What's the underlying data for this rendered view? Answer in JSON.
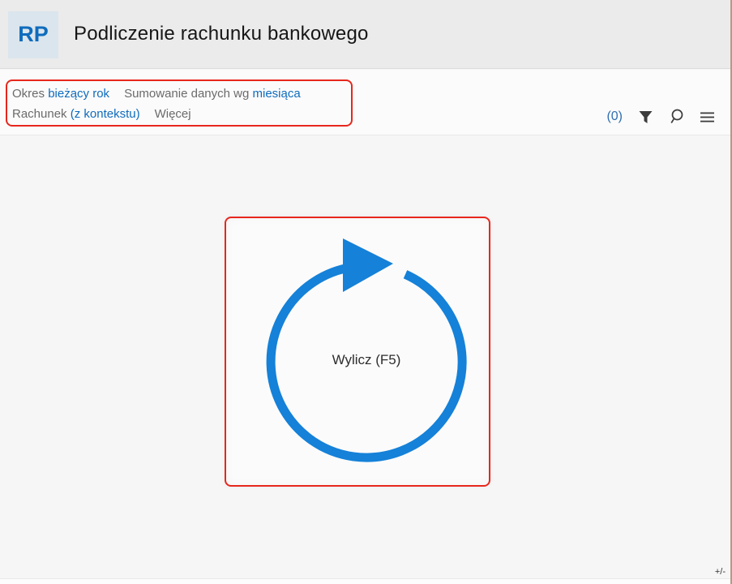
{
  "header": {
    "badge": "RP",
    "title": "Podliczenie rachunku bankowego"
  },
  "toolbar": {
    "menu": {
      "okres_label": "Okres",
      "okres_value": "bieżący rok",
      "sumowanie_label": "Sumowanie danych wg",
      "sumowanie_value": "miesiąca",
      "rachunek_label": "Rachunek",
      "rachunek_value": "(z kontekstu)",
      "wiecej_label": "Więcej"
    },
    "filter_count": "(0)",
    "icons": {
      "filter": "funnel-icon",
      "search": "magnifier-icon",
      "menu": "hamburger-menu-icon"
    }
  },
  "main": {
    "run_button": {
      "label": "Wylicz (F5)",
      "icon": "circular-arrow-refresh-icon"
    }
  },
  "footer": {
    "zoom_hint": "+/-"
  },
  "colors": {
    "highlight_red": "#e7271d",
    "accent_blue": "#1581d8",
    "link_blue": "#0f6cbd",
    "badge_bg": "#dbe5ed",
    "header_bg": "#ebebeb",
    "icon_gray": "#3c3c3c",
    "window_edge": "#b49a85"
  }
}
